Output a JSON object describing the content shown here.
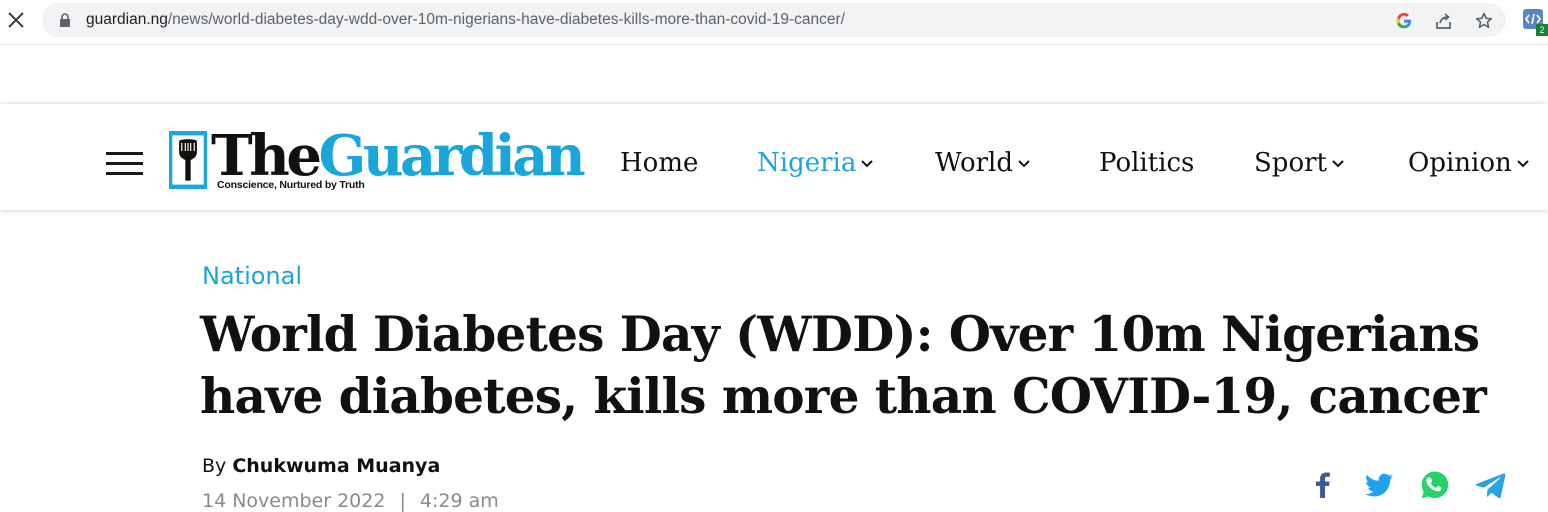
{
  "browser": {
    "url_host": "guardian.ng",
    "url_path": "/news/world-diabetes-day-wdd-over-10m-nigerians-have-diabetes-kills-more-than-covid-19-cancer/",
    "extension_badge": "2",
    "icons": [
      "close-icon",
      "lock-icon",
      "google-icon",
      "share-icon",
      "bookmark-star-icon",
      "extension-icon"
    ]
  },
  "site": {
    "logo_the": "The",
    "logo_guardian": "Guardian",
    "tagline": "Conscience, Nurtured by Truth",
    "brand_color": "#1aa6db",
    "nav": [
      {
        "label": "Home"
      },
      {
        "label": "Nigeria"
      },
      {
        "label": "World"
      },
      {
        "label": "Politics"
      },
      {
        "label": "Sport"
      },
      {
        "label": "Opinion"
      }
    ]
  },
  "article": {
    "category": "National",
    "headline": "World Diabetes Day (WDD): Over 10m Nigerians have diabetes, kills more than COVID-19, cancer",
    "by": "By",
    "author": "Chukwuma Muanya",
    "date": "14 November 2022",
    "separator": "|",
    "time": "4:29 am"
  },
  "share": {
    "icons": [
      "facebook-icon",
      "twitter-icon",
      "whatsapp-icon",
      "telegram-icon"
    ],
    "colors": {
      "facebook": "#3b5998",
      "twitter": "#1da1f2",
      "whatsapp": "#25d366",
      "telegram": "#2aa3de"
    }
  }
}
